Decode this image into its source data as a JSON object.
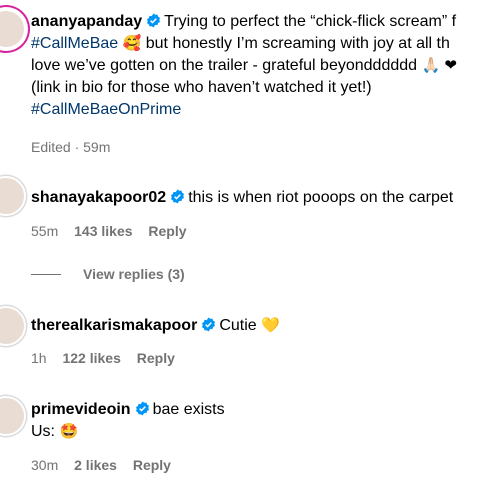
{
  "post_caption": {
    "username": "ananyapanday",
    "line1_text": "Trying to perfect the “chick-flick scream” f",
    "line2_hashtag": "#CallMeBae",
    "line2_emoji": "🥰",
    "line2_text": "but honestly I’m screaming with joy at all th",
    "line3_text": "love we’ve gotten on the trailer - grateful beyondddddd",
    "line3_emoji": "🙏🏻 ❤",
    "line4_text": "(link in bio for those who haven’t watched it yet!)",
    "line5_hashtag": "#CallMeBaeOnPrime",
    "edited": "Edited · 59m"
  },
  "comments": [
    {
      "username": "shanayakapoor02",
      "text": "this is when riot pooops on the carpet",
      "time": "55m",
      "likes": "143 likes",
      "reply": "Reply",
      "view_replies": "View replies (3)"
    },
    {
      "username": "therealkarismakapoor",
      "text": "Cutie",
      "emoji": "💛",
      "time": "1h",
      "likes": "122 likes",
      "reply": "Reply"
    },
    {
      "username": "primevideoin",
      "text": "bae exists",
      "text_line2": "Us:",
      "emoji": "🤩",
      "time": "30m",
      "likes": "2 likes",
      "reply": "Reply"
    }
  ],
  "icons": {
    "verified": "verified-badge-icon"
  },
  "colors": {
    "verified": "#0095f6",
    "hashtag": "#00376b",
    "meta": "#737373",
    "story_ring": "#d6249f"
  }
}
